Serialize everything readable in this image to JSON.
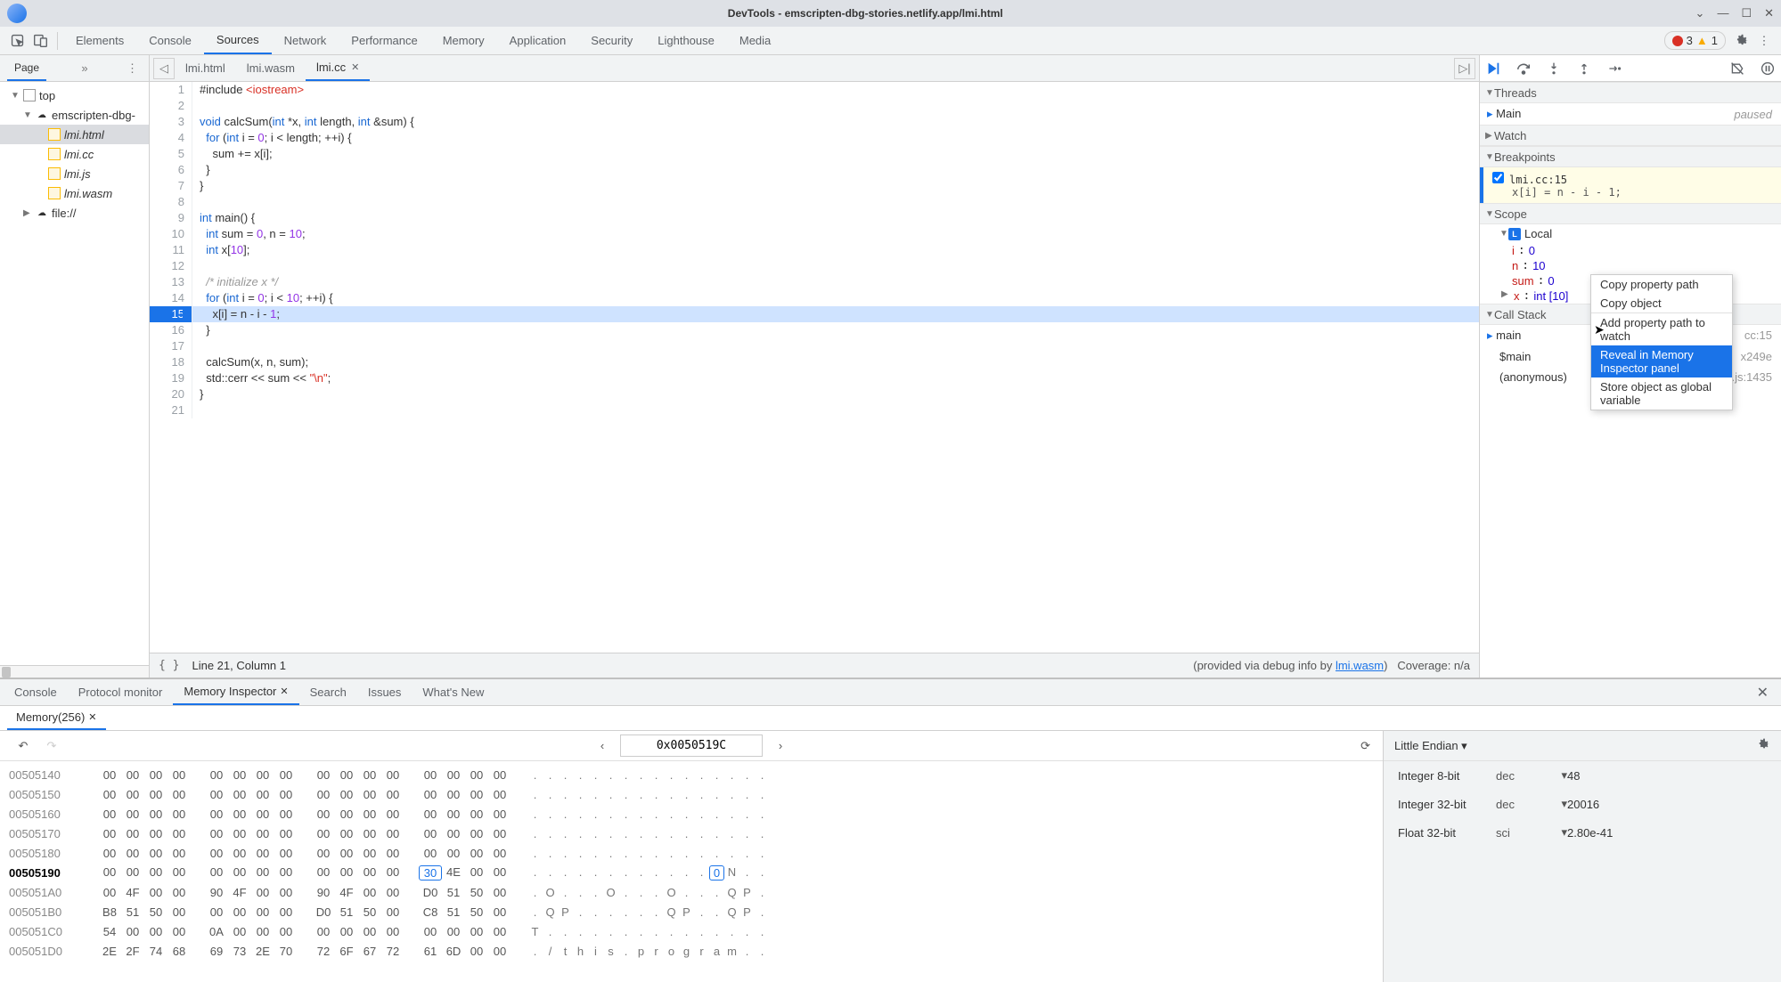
{
  "window": {
    "title": "DevTools - emscripten-dbg-stories.netlify.app/lmi.html"
  },
  "mainTabs": [
    "Elements",
    "Console",
    "Sources",
    "Network",
    "Performance",
    "Memory",
    "Application",
    "Security",
    "Lighthouse",
    "Media"
  ],
  "mainActive": "Sources",
  "warnErr": {
    "errors": "3",
    "warnings": "1"
  },
  "page": {
    "tab": "Page",
    "tree": {
      "top": "top",
      "domain": "emscripten-dbg-",
      "files": [
        "lmi.html",
        "lmi.cc",
        "lmi.js",
        "lmi.wasm"
      ],
      "fileProto": "file://",
      "selected": "lmi.html"
    }
  },
  "editor": {
    "tabs": [
      "lmi.html",
      "lmi.wasm",
      "lmi.cc"
    ],
    "activeTab": "lmi.cc",
    "execLine": 15,
    "lines": [
      {
        "n": 1,
        "t": "#include <iostream>",
        "hl": "pre"
      },
      {
        "n": 2,
        "t": ""
      },
      {
        "n": 3,
        "t": "void calcSum(int *x, int length, int &sum) {",
        "hl": "kw"
      },
      {
        "n": 4,
        "t": "  for (int i = 0; i < length; ++i) {",
        "hl": "kw"
      },
      {
        "n": 5,
        "t": "    sum += x[i];"
      },
      {
        "n": 6,
        "t": "  }"
      },
      {
        "n": 7,
        "t": "}"
      },
      {
        "n": 8,
        "t": ""
      },
      {
        "n": 9,
        "t": "int main() {",
        "hl": "kw"
      },
      {
        "n": 10,
        "t": "  int sum = 0, n = 10;",
        "hl": "kw"
      },
      {
        "n": 11,
        "t": "  int x[10];",
        "hl": "kw"
      },
      {
        "n": 12,
        "t": ""
      },
      {
        "n": 13,
        "t": "  /* initialize x */",
        "hl": "com"
      },
      {
        "n": 14,
        "t": "  for (int i = 0; i < 10; ++i) {",
        "hl": "kw"
      },
      {
        "n": 15,
        "t": "    x[i] = n - i - 1;"
      },
      {
        "n": 16,
        "t": "  }"
      },
      {
        "n": 17,
        "t": ""
      },
      {
        "n": 18,
        "t": "  calcSum(x, n, sum);"
      },
      {
        "n": 19,
        "t": "  std::cerr << sum << \"\\n\";",
        "hl": "str"
      },
      {
        "n": 20,
        "t": "}"
      },
      {
        "n": 21,
        "t": ""
      }
    ],
    "status": {
      "lineCol": "Line 21, Column 1",
      "providedLeft": "(provided via debug info by ",
      "providedLink": "lmi.wasm",
      "providedRight": ")",
      "coverage": "Coverage: n/a"
    }
  },
  "debugger": {
    "threadsTitle": "Threads",
    "thread": {
      "name": "Main",
      "state": "paused"
    },
    "watchTitle": "Watch",
    "bpTitle": "Breakpoints",
    "bp": {
      "loc": "lmi.cc:15",
      "snip": "x[i] = n - i - 1;"
    },
    "scopeTitle": "Scope",
    "localLabel": "Local",
    "scope": [
      {
        "k": "i",
        "v": "0"
      },
      {
        "k": "n",
        "v": "10"
      },
      {
        "k": "sum",
        "v": "0"
      },
      {
        "k": "x",
        "v": "int [10]",
        "expand": true
      }
    ],
    "callstackTitle": "Call Stack",
    "stack": [
      {
        "fn": "main",
        "src": "cc:15"
      },
      {
        "fn": "$main",
        "src": "x249e"
      },
      {
        "fn": "(anonymous)",
        "src": "lmi.js:1435"
      }
    ]
  },
  "ctxMenu": {
    "items": [
      "Copy property path",
      "Copy object",
      "Add property path to watch",
      "Reveal in Memory Inspector panel",
      "Store object as global variable"
    ],
    "selected": "Reveal in Memory Inspector panel"
  },
  "drawer": {
    "tabs": [
      "Console",
      "Protocol monitor",
      "Memory Inspector",
      "Search",
      "Issues",
      "What's New"
    ],
    "activeTab": "Memory Inspector"
  },
  "memory": {
    "tab": "Memory(256)",
    "addr": "0x0050519C",
    "endian": "Little Endian",
    "rowsAddr": [
      "00505140",
      "00505150",
      "00505160",
      "00505170",
      "00505180",
      "00505190",
      "005051A0",
      "005051B0",
      "005051C0",
      "005051D0"
    ],
    "rowsHex": [
      [
        "00",
        "00",
        "00",
        "00",
        "00",
        "00",
        "00",
        "00",
        "00",
        "00",
        "00",
        "00",
        "00",
        "00",
        "00",
        "00"
      ],
      [
        "00",
        "00",
        "00",
        "00",
        "00",
        "00",
        "00",
        "00",
        "00",
        "00",
        "00",
        "00",
        "00",
        "00",
        "00",
        "00"
      ],
      [
        "00",
        "00",
        "00",
        "00",
        "00",
        "00",
        "00",
        "00",
        "00",
        "00",
        "00",
        "00",
        "00",
        "00",
        "00",
        "00"
      ],
      [
        "00",
        "00",
        "00",
        "00",
        "00",
        "00",
        "00",
        "00",
        "00",
        "00",
        "00",
        "00",
        "00",
        "00",
        "00",
        "00"
      ],
      [
        "00",
        "00",
        "00",
        "00",
        "00",
        "00",
        "00",
        "00",
        "00",
        "00",
        "00",
        "00",
        "00",
        "00",
        "00",
        "00"
      ],
      [
        "00",
        "00",
        "00",
        "00",
        "00",
        "00",
        "00",
        "00",
        "00",
        "00",
        "00",
        "00",
        "30",
        "4E",
        "00",
        "00"
      ],
      [
        "00",
        "4F",
        "00",
        "00",
        "90",
        "4F",
        "00",
        "00",
        "90",
        "4F",
        "00",
        "00",
        "D0",
        "51",
        "50",
        "00"
      ],
      [
        "B8",
        "51",
        "50",
        "00",
        "00",
        "00",
        "00",
        "00",
        "D0",
        "51",
        "50",
        "00",
        "C8",
        "51",
        "50",
        "00"
      ],
      [
        "54",
        "00",
        "00",
        "00",
        "0A",
        "00",
        "00",
        "00",
        "00",
        "00",
        "00",
        "00",
        "00",
        "00",
        "00",
        "00"
      ],
      [
        "2E",
        "2F",
        "74",
        "68",
        "69",
        "73",
        "2E",
        "70",
        "72",
        "6F",
        "67",
        "72",
        "61",
        "6D",
        "00",
        "00"
      ]
    ],
    "rowsAsc": [
      [
        ".",
        ".",
        ".",
        ".",
        ".",
        ".",
        ".",
        ".",
        ".",
        ".",
        ".",
        ".",
        ".",
        ".",
        ".",
        "."
      ],
      [
        ".",
        ".",
        ".",
        ".",
        ".",
        ".",
        ".",
        ".",
        ".",
        ".",
        ".",
        ".",
        ".",
        ".",
        ".",
        "."
      ],
      [
        ".",
        ".",
        ".",
        ".",
        ".",
        ".",
        ".",
        ".",
        ".",
        ".",
        ".",
        ".",
        ".",
        ".",
        ".",
        "."
      ],
      [
        ".",
        ".",
        ".",
        ".",
        ".",
        ".",
        ".",
        ".",
        ".",
        ".",
        ".",
        ".",
        ".",
        ".",
        ".",
        "."
      ],
      [
        ".",
        ".",
        ".",
        ".",
        ".",
        ".",
        ".",
        ".",
        ".",
        ".",
        ".",
        ".",
        ".",
        ".",
        ".",
        "."
      ],
      [
        ".",
        ".",
        ".",
        ".",
        ".",
        ".",
        ".",
        ".",
        ".",
        ".",
        ".",
        ".",
        "0",
        "N",
        ".",
        "."
      ],
      [
        ".",
        "O",
        ".",
        ".",
        ".",
        "O",
        ".",
        ".",
        ".",
        "O",
        ".",
        ".",
        ".",
        "Q",
        "P",
        "."
      ],
      [
        ".",
        "Q",
        "P",
        ".",
        ".",
        ".",
        ".",
        ".",
        ".",
        "Q",
        "P",
        ".",
        ".",
        "Q",
        "P",
        "."
      ],
      [
        "T",
        ".",
        ".",
        ".",
        ".",
        ".",
        ".",
        ".",
        ".",
        ".",
        ".",
        ".",
        ".",
        ".",
        ".",
        "."
      ],
      [
        ".",
        "/",
        "t",
        "h",
        "i",
        "s",
        ".",
        "p",
        "r",
        "o",
        "g",
        "r",
        "a",
        "m",
        ".",
        "."
      ]
    ],
    "curRowIndex": 5,
    "hlHexByte": 12,
    "hlAscByte": 12,
    "values": [
      {
        "type": "Integer 8-bit",
        "fmt": "dec",
        "val": "48"
      },
      {
        "type": "Integer 32-bit",
        "fmt": "dec",
        "val": "20016"
      },
      {
        "type": "Float 32-bit",
        "fmt": "sci",
        "val": "2.80e-41"
      }
    ]
  }
}
